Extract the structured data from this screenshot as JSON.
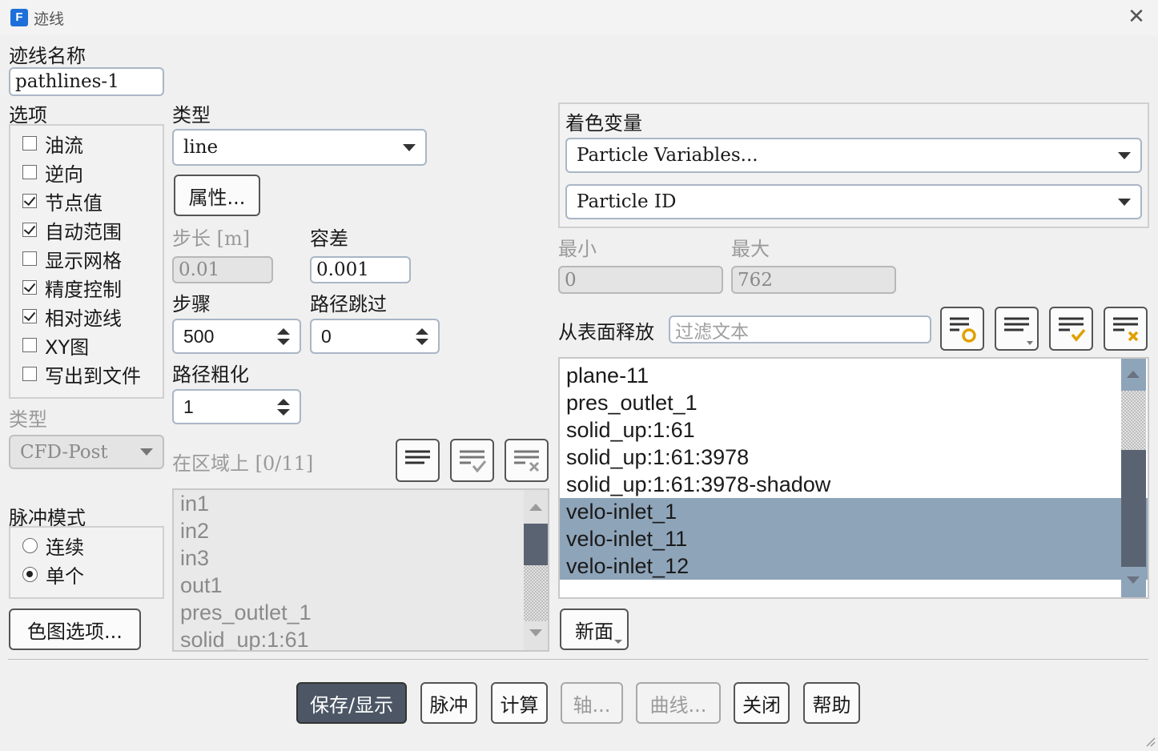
{
  "window": {
    "title": "迹线",
    "app_icon": "F"
  },
  "name_label": "迹线名称",
  "name_value": "pathlines-1",
  "options": {
    "label": "选项",
    "items": [
      {
        "label": "油流",
        "checked": false
      },
      {
        "label": "逆向",
        "checked": false
      },
      {
        "label": "节点值",
        "checked": true
      },
      {
        "label": "自动范围",
        "checked": true
      },
      {
        "label": "显示网格",
        "checked": false
      },
      {
        "label": "精度控制",
        "checked": true
      },
      {
        "label": "相对迹线",
        "checked": true
      },
      {
        "label": "XY图",
        "checked": false
      },
      {
        "label": "写出到文件",
        "checked": false
      }
    ]
  },
  "lower_type": {
    "label": "类型",
    "value": "CFD-Post"
  },
  "pulse": {
    "label": "脉冲模式",
    "items": [
      {
        "label": "连续",
        "selected": false
      },
      {
        "label": "单个",
        "selected": true
      }
    ]
  },
  "colormap_button": "色图选项...",
  "type": {
    "label": "类型",
    "value": "line"
  },
  "attributes_button": "属性...",
  "step_length": {
    "label": "步长 [m]",
    "value": "0.01"
  },
  "tolerance": {
    "label": "容差",
    "value": "0.001"
  },
  "steps": {
    "label": "步骤",
    "value": "500"
  },
  "path_skip": {
    "label": "路径跳过",
    "value": "0"
  },
  "path_coarsen": {
    "label": "路径粗化",
    "value": "1"
  },
  "zones": {
    "label": "在区域上 [0/11]",
    "items": [
      "in1",
      "in2",
      "in3",
      "out1",
      "pres_outlet_1",
      "solid_up:1:61"
    ]
  },
  "color_by": {
    "label": "着色变量",
    "category": "Particle Variables...",
    "variable": "Particle ID"
  },
  "min": {
    "label": "最小",
    "value": "0"
  },
  "max": {
    "label": "最大",
    "value": "762"
  },
  "release": {
    "label": "从表面释放",
    "filter_placeholder": "过滤文本",
    "items": [
      {
        "label": "plane-11",
        "selected": false
      },
      {
        "label": "pres_outlet_1",
        "selected": false
      },
      {
        "label": "solid_up:1:61",
        "selected": false
      },
      {
        "label": "solid_up:1:61:3978",
        "selected": false
      },
      {
        "label": "solid_up:1:61:3978-shadow",
        "selected": false
      },
      {
        "label": "velo-inlet_1",
        "selected": true
      },
      {
        "label": "velo-inlet_11",
        "selected": true
      },
      {
        "label": "velo-inlet_12",
        "selected": true
      }
    ]
  },
  "new_surface_button": "新面",
  "footer": {
    "save_display": "保存/显示",
    "pulse": "脉冲",
    "compute": "计算",
    "axes": "轴...",
    "curves": "曲线...",
    "close": "关闭",
    "help": "帮助"
  },
  "colors": {
    "accent": "#4c5665",
    "selection": "#8ea4b9",
    "icon_accent": "#e0a000"
  }
}
